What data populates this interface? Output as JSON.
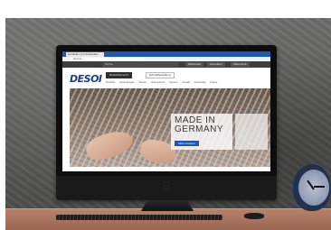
{
  "browser": {
    "tab_label": "Hersteller von Schrauben",
    "url": "desoi.de"
  },
  "site": {
    "search_placeholder": "Suche",
    "top_links": [
      "Merkzettel",
      "Anmelden",
      "Warenkorb"
    ],
    "logo": "DESOI",
    "header_buttons": [
      "Bestellübersicht",
      "Schnellbestellung"
    ],
    "nav_items": [
      "Produkte",
      "Anwendungen",
      "Service",
      "Unternehmen",
      "Karriere",
      "Kontakt",
      "Downloads",
      "Presse"
    ],
    "hero": {
      "title_line1": "MADE IN",
      "title_line2": "GERMANY",
      "button": "Mehr erfahren"
    }
  }
}
